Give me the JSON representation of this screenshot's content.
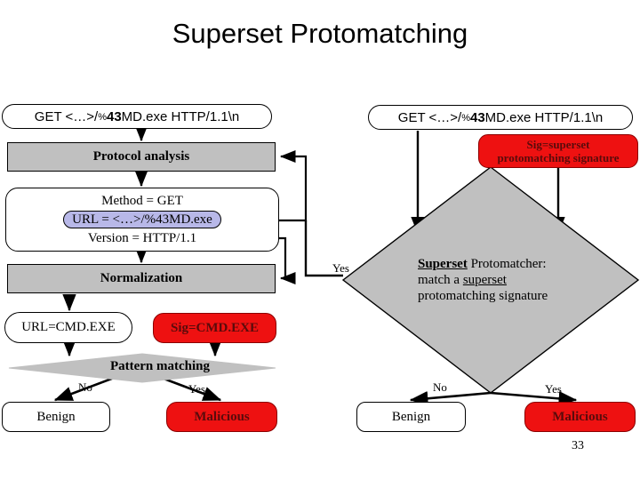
{
  "slide": {
    "title": "Superset Protomatching",
    "page_number": "33",
    "background_color": "#ffffff"
  },
  "colors": {
    "process_gray": "#c0c0c0",
    "alert_red": "#ee1111",
    "alert_red_text": "#5a0b0b",
    "url_highlight": "#b8b8e8",
    "outline": "#000000"
  },
  "left_pipeline": {
    "packet": {
      "prefix": "GET  <…>/",
      "percent": "%",
      "code": "43",
      "suffix": "MD.exe  HTTP/1.1\\n"
    },
    "protocol_analysis": "Protocol analysis",
    "parsed": {
      "method": "Method = GET",
      "url": "URL = <…>/%43MD.exe",
      "version": "Version = HTTP/1.1"
    },
    "normalization": "Normalization",
    "normalized_url": "URL=CMD.EXE",
    "signature": "Sig=CMD.EXE",
    "decision": "Pattern matching",
    "edge_no": "No",
    "edge_yes": "Yes",
    "outcome_benign": "Benign",
    "outcome_malicious": "Malicious"
  },
  "right_pipeline": {
    "packet": {
      "prefix": "GET  <…>/",
      "percent": "%",
      "code": "43",
      "suffix": "MD.exe  HTTP/1.1\\n"
    },
    "signature_line1": "Sig=superset",
    "signature_line2": "protomatching signature",
    "matcher": {
      "line1_underlined": "Superset",
      "line1_rest": " Protomatcher:",
      "line2_prefix": "match a ",
      "line2_underlined": "superset",
      "line3": "protomatching signature"
    },
    "edge_yes_into_matcher": "Yes",
    "edge_no": "No",
    "edge_yes": "Yes",
    "outcome_benign": "Benign",
    "outcome_malicious": "Malicious"
  }
}
